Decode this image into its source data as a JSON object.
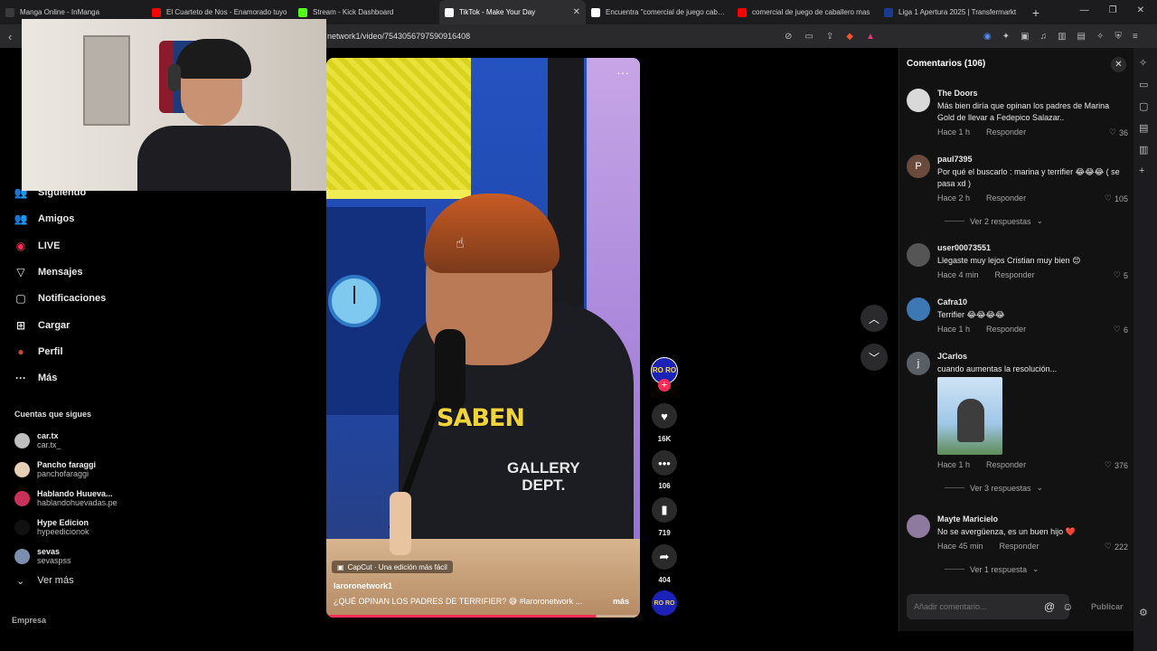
{
  "tabs": [
    {
      "title": "Manga Online - InManga",
      "color": "#3a3a3a",
      "active": false
    },
    {
      "title": "El Cuarteto de Nos - Enamorado tuyo",
      "color": "#ff0000",
      "active": false
    },
    {
      "title": "Stream - Kick Dashboard",
      "color": "#53fc18",
      "active": false
    },
    {
      "title": "TikTok - Make Your Day",
      "color": "#ffffff",
      "active": true
    },
    {
      "title": "Encuentra \"comercial de juego caballero\"",
      "color": "#ffffff",
      "active": false
    },
    {
      "title": "comercial de juego de caballero mas",
      "color": "#ff0000",
      "active": false
    },
    {
      "title": "Liga 1 Apertura 2025 | Transfermarkt",
      "color": "#1a3b8f",
      "active": false
    }
  ],
  "new_tab": "+",
  "address": {
    "url": "network1/video/7543056797590916408"
  },
  "nav": [
    {
      "label": "Siguiendo",
      "icon": "following-icon"
    },
    {
      "label": "Amigos",
      "icon": "friends-icon"
    },
    {
      "label": "LIVE",
      "icon": "live-icon"
    },
    {
      "label": "Mensajes",
      "icon": "messages-icon"
    },
    {
      "label": "Notificaciones",
      "icon": "notifications-icon"
    },
    {
      "label": "Cargar",
      "icon": "upload-icon"
    },
    {
      "label": "Perfil",
      "icon": "profile-icon"
    },
    {
      "label": "Más",
      "icon": "more-icon"
    }
  ],
  "following": {
    "heading": "Cuentas que sigues",
    "accounts": [
      {
        "name": "car.tx",
        "handle": "car.tx_",
        "color": "#bfbfbf"
      },
      {
        "name": "Pancho faraggi",
        "handle": "panchofaraggi",
        "color": "#e6cfb5"
      },
      {
        "name": "Hablando Huueva...",
        "handle": "hablandohuevadas.pe",
        "color": "#c8325a"
      },
      {
        "name": "Hype Edicion",
        "handle": "hypeedicionok",
        "color": "#111111"
      },
      {
        "name": "sevas",
        "handle": "sevaspss",
        "color": "#7a8fb0"
      }
    ],
    "see_more": "Ver más"
  },
  "footer": "Empresa",
  "video": {
    "overlay_word": "SABEN",
    "shirt_text_1": "GALLERY",
    "shirt_text_2": "DEPT.",
    "capcut": "CapCut · Una edición más fácil",
    "author": "laroronetwork1",
    "caption": "¿QUÉ OPINAN LOS PADRES DE TERRIFIER? 😅 #laroronetwork ...",
    "more": "más",
    "progress": 0.86,
    "menu": "···"
  },
  "actions": {
    "avatar_text": "RO RO",
    "likes": "16K",
    "comments": "106",
    "saves": "719",
    "shares": "404"
  },
  "comments_panel": {
    "title": "Comentarios (106)",
    "placeholder": "Añadir comentario...",
    "publish": "Publicar",
    "items": [
      {
        "user": "The Doors",
        "text": "Más bien diría que opinan los padres de Marina Gold de llevar a Fedepico Salazar..",
        "time": "Hace 1 h",
        "reply": "Responder",
        "likes": "36",
        "avatar": "#d9d9d9",
        "initial": ""
      },
      {
        "user": "paul7395",
        "text": "Por qué el buscarlo : marina y terrifier 😂😂😂 ( se pasa xd )",
        "time": "Hace 2 h",
        "reply": "Responder",
        "likes": "105",
        "avatar": "#6b4a3e",
        "initial": "P",
        "replies": "Ver 2 respuestas"
      },
      {
        "user": "user00073551",
        "text": "Llegaste muy lejos Cristian muy bien 😊",
        "time": "Hace 4 min",
        "reply": "Responder",
        "likes": "5",
        "avatar": "#555555",
        "initial": ""
      },
      {
        "user": "Cafra10",
        "text": "Terrifier 😂😂😂😂",
        "time": "Hace 1 h",
        "reply": "Responder",
        "likes": "6",
        "avatar": "#3d78b5",
        "initial": ""
      },
      {
        "user": "JCarlos",
        "text": "cuando aumentas la resolución...",
        "time": "Hace 1 h",
        "reply": "Responder",
        "likes": "376",
        "avatar": "#5a5f66",
        "initial": "j",
        "replies": "Ver 3 respuestas"
      },
      {
        "user": "Mayte Maricielo",
        "text": "No se avergüenza, es un buen hijo ❤️",
        "time": "Hace 45 min",
        "reply": "Responder",
        "likes": "222",
        "avatar": "#8d7a9e",
        "initial": "",
        "replies": "Ver 1 respuesta"
      }
    ]
  }
}
